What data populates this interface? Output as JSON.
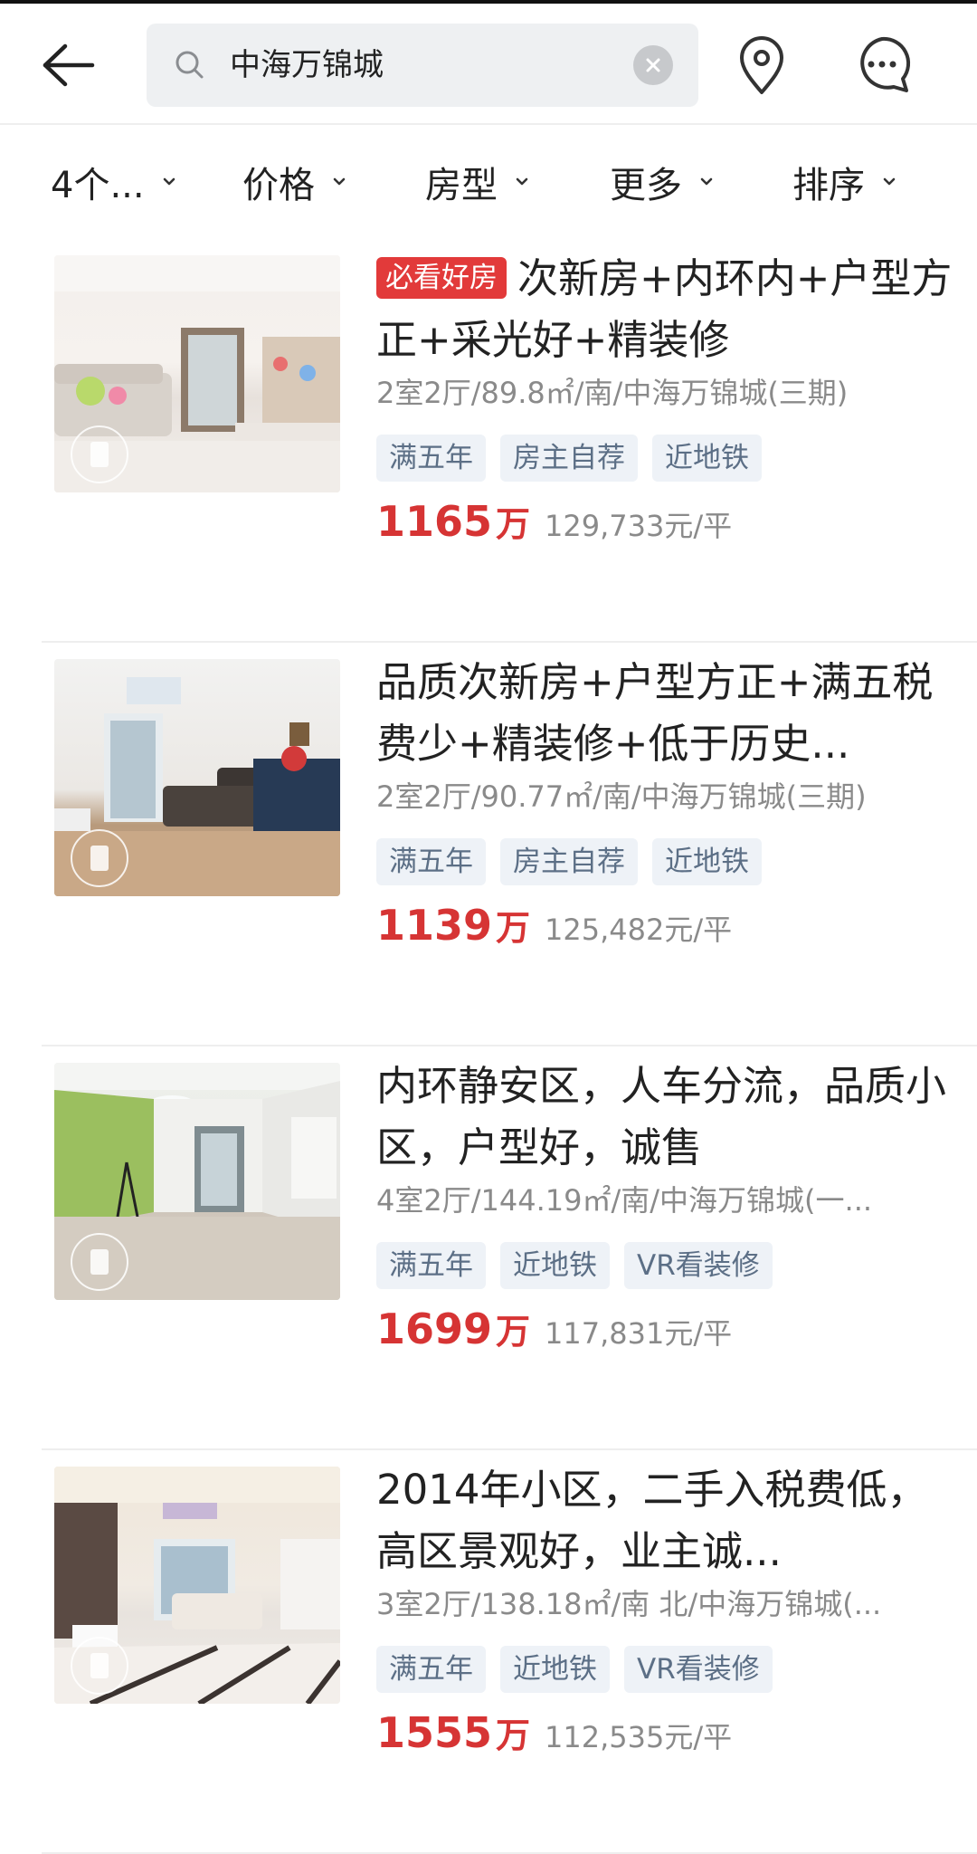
{
  "header": {
    "search_value": "中海万锦城"
  },
  "filters": [
    {
      "label": "4个..."
    },
    {
      "label": "价格"
    },
    {
      "label": "房型"
    },
    {
      "label": "更多"
    },
    {
      "label": "排序"
    }
  ],
  "listings": [
    {
      "badge": "必看好房",
      "title": "次新房+内环内+户型方正+采光好+精装修",
      "meta": "2室2厅/89.8㎡/南/中海万锦城(三期)",
      "tags": [
        "满五年",
        "房主自荐",
        "近地铁"
      ],
      "price": "1165",
      "price_unit": "万",
      "unit_price": "129,733元/平"
    },
    {
      "title": "品质次新房+户型方正+满五税费少+精装修+低于历史...",
      "meta": "2室2厅/90.77㎡/南/中海万锦城(三期)",
      "tags": [
        "满五年",
        "房主自荐",
        "近地铁"
      ],
      "price": "1139",
      "price_unit": "万",
      "unit_price": "125,482元/平"
    },
    {
      "title": "内环静安区，人车分流，品质小区，户型好，诚售",
      "meta": "4室2厅/144.19㎡/南/中海万锦城(一...",
      "tags": [
        "满五年",
        "近地铁",
        "VR看装修"
      ],
      "price": "1699",
      "price_unit": "万",
      "unit_price": "117,831元/平"
    },
    {
      "title": "2014年小区，二手入税费低，高区景观好，业主诚...",
      "meta": "3室2厅/138.18㎡/南 北/中海万锦城(...",
      "tags": [
        "满五年",
        "近地铁",
        "VR看装修"
      ],
      "price": "1555",
      "price_unit": "万",
      "unit_price": "112,535元/平"
    }
  ],
  "icons": {
    "back": "back-arrow-icon",
    "search": "search-icon",
    "clear": "clear-icon",
    "location": "location-pin-icon",
    "message": "message-icon",
    "vr": "vr-icon"
  },
  "colors": {
    "accent_red": "#d63434",
    "badge_red": "#e23a3a",
    "tag_bg": "#eef2f7",
    "tag_text": "#5c6f86"
  }
}
